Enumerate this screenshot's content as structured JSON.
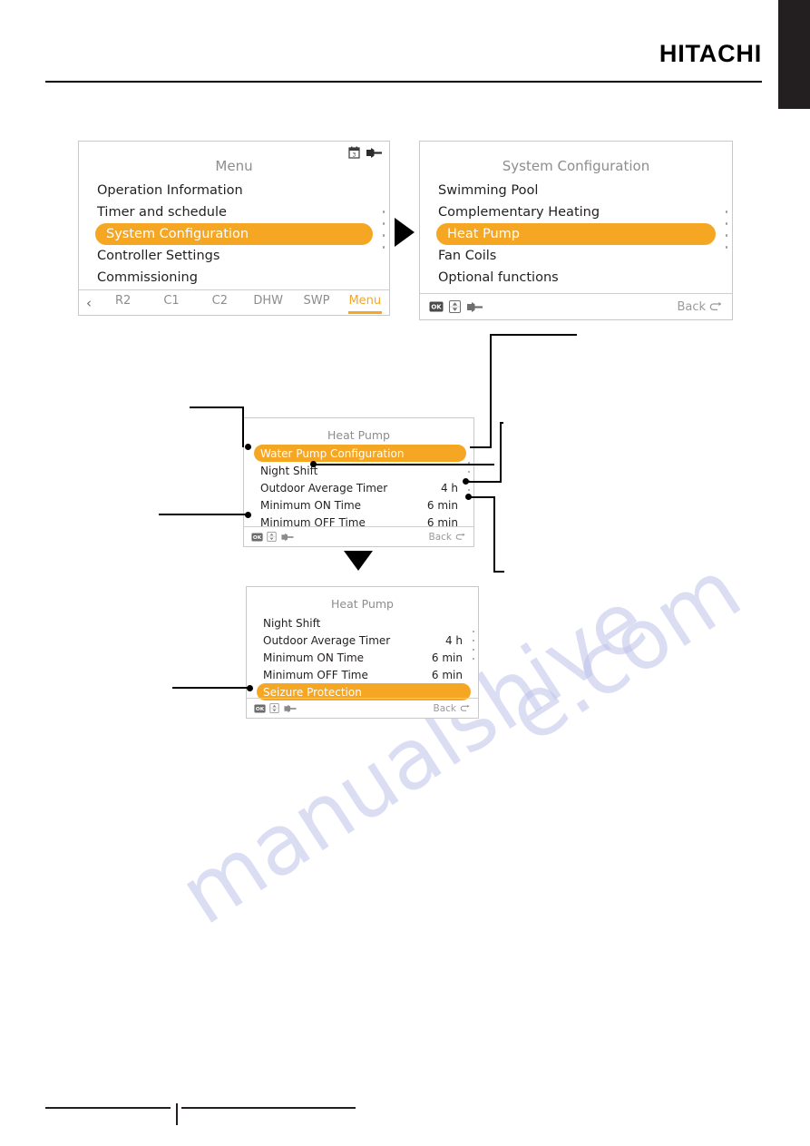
{
  "page": {
    "brand": "HITACHI",
    "watermark_lines": [
      "e.com",
      "manualshive"
    ]
  },
  "screens": [
    {
      "id": "menu",
      "title": "Menu",
      "header_icons": [
        "schedule-icon",
        "wrench-icon"
      ],
      "items": [
        {
          "label": "Operation Information",
          "value": "",
          "selected": false
        },
        {
          "label": "Timer and schedule",
          "value": "",
          "selected": false
        },
        {
          "label": "System Configuration",
          "value": "",
          "selected": true
        },
        {
          "label": "Controller Settings",
          "value": "",
          "selected": false
        },
        {
          "label": "Commissioning",
          "value": "",
          "selected": false
        }
      ],
      "tabs": [
        {
          "label": "R2",
          "active": false
        },
        {
          "label": "C1",
          "active": false
        },
        {
          "label": "C2",
          "active": false
        },
        {
          "label": "DHW",
          "active": false
        },
        {
          "label": "SWP",
          "active": false
        },
        {
          "label": "Menu",
          "active": true
        }
      ],
      "tab_back_arrow": "‹"
    },
    {
      "id": "system-configuration",
      "title": "System Configuration",
      "items": [
        {
          "label": "Swimming Pool",
          "value": "",
          "selected": false
        },
        {
          "label": "Complementary Heating",
          "value": "",
          "selected": false
        },
        {
          "label": "Heat Pump",
          "value": "",
          "selected": true
        },
        {
          "label": "Fan Coils",
          "value": "",
          "selected": false
        },
        {
          "label": "Optional functions",
          "value": "",
          "selected": false
        }
      ],
      "bottom_icons": [
        "ok-icon",
        "updown-icon",
        "wrench-icon"
      ],
      "back_label": "Back"
    },
    {
      "id": "heat-pump-top",
      "title": "Heat Pump",
      "items": [
        {
          "label": "Water Pump Configuration",
          "value": "",
          "selected": true
        },
        {
          "label": "Night Shift",
          "value": "",
          "selected": false
        },
        {
          "label": "Outdoor Average Timer",
          "value": "4 h",
          "selected": false
        },
        {
          "label": "Minimum ON Time",
          "value": "6 min",
          "selected": false
        },
        {
          "label": "Minimum OFF Time",
          "value": "6 min",
          "selected": false
        }
      ],
      "bottom_icons": [
        "ok-icon",
        "updown-icon",
        "wrench-icon"
      ],
      "back_label": "Back"
    },
    {
      "id": "heat-pump-bottom",
      "title": "Heat Pump",
      "items": [
        {
          "label": "Night Shift",
          "value": "",
          "selected": false
        },
        {
          "label": "Outdoor Average Timer",
          "value": "4 h",
          "selected": false
        },
        {
          "label": "Minimum ON Time",
          "value": "6 min",
          "selected": false
        },
        {
          "label": "Minimum OFF Time",
          "value": "6 min",
          "selected": false
        },
        {
          "label": "Seizure Protection",
          "value": "",
          "selected": true
        }
      ],
      "bottom_icons": [
        "ok-icon",
        "updown-icon",
        "wrench-icon"
      ],
      "back_label": "Back"
    }
  ],
  "colors": {
    "accent": "#f5a623",
    "text": "#231f20",
    "muted": "#8d8d8d",
    "screen_border": "#c9c9c9",
    "corner_block": "#231f20"
  }
}
